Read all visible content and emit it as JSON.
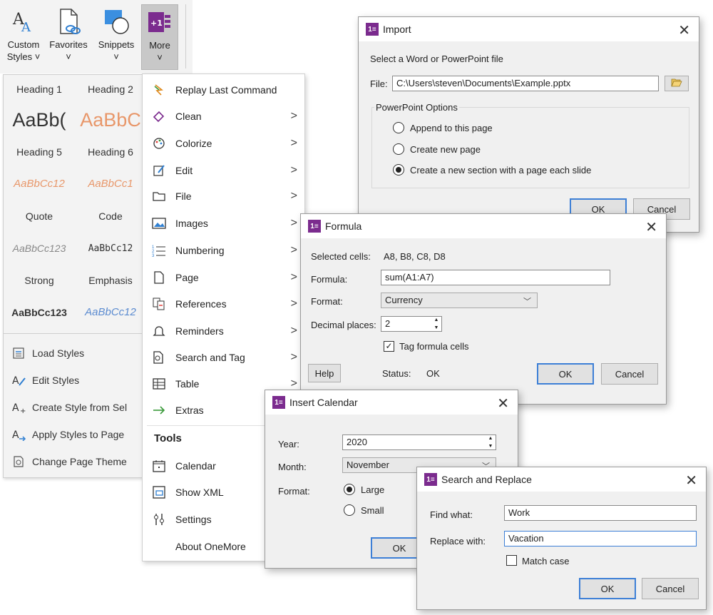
{
  "ribbon": {
    "buttons": [
      {
        "line1": "Custom",
        "line2": "Styles ˅",
        "icon": "custom-styles-icon"
      },
      {
        "line1": "Favorites",
        "line2": "˅",
        "icon": "favorites-icon"
      },
      {
        "line1": "Snippets",
        "line2": "˅",
        "icon": "snippets-icon"
      },
      {
        "line1": "More",
        "line2": "˅",
        "icon": "onemore-icon"
      }
    ]
  },
  "gallery": {
    "styles": [
      "Heading 1",
      "Heading 2",
      "AaBb(",
      "AaBbC",
      "Heading 5",
      "Heading 6",
      "AaBbCc12",
      "AaBbCc1",
      "Quote",
      "Code",
      "AaBbCc123",
      "AaBbCc12",
      "Strong",
      "Emphasis",
      "AaBbCc123",
      "AaBbCc12"
    ],
    "commands": [
      {
        "label": "Load Styles",
        "icon": "load-styles-icon"
      },
      {
        "label": "Edit Styles",
        "icon": "edit-styles-icon"
      },
      {
        "label": "Create Style from Sel",
        "icon": "create-style-icon"
      },
      {
        "label": "Apply Styles to Page",
        "icon": "apply-styles-icon"
      },
      {
        "label": "Change Page Theme",
        "icon": "page-theme-icon"
      }
    ]
  },
  "menu": {
    "items": [
      {
        "label": "Replay Last Command",
        "icon": "replay-icon",
        "submenu": false
      },
      {
        "label": "Clean",
        "icon": "eraser-icon",
        "submenu": true
      },
      {
        "label": "Colorize",
        "icon": "palette-icon",
        "submenu": true
      },
      {
        "label": "Edit",
        "icon": "edit-icon",
        "submenu": true
      },
      {
        "label": "File",
        "icon": "folder-icon",
        "submenu": true
      },
      {
        "label": "Images",
        "icon": "image-icon",
        "submenu": true
      },
      {
        "label": "Numbering",
        "icon": "numbering-icon",
        "submenu": true
      },
      {
        "label": "Page",
        "icon": "page-icon",
        "submenu": true
      },
      {
        "label": "References",
        "icon": "references-icon",
        "submenu": true
      },
      {
        "label": "Reminders",
        "icon": "bell-icon",
        "submenu": true
      },
      {
        "label": "Search and Tag",
        "icon": "search-tag-icon",
        "submenu": true
      },
      {
        "label": "Table",
        "icon": "table-icon",
        "submenu": true
      },
      {
        "label": "Extras",
        "icon": "arrow-right-icon",
        "submenu": true
      }
    ],
    "tools_heading": "Tools",
    "tools": [
      {
        "label": "Calendar",
        "icon": "calendar-icon"
      },
      {
        "label": "Show XML",
        "icon": "xml-icon"
      },
      {
        "label": "Settings",
        "icon": "settings-icon"
      },
      {
        "label": "About OneMore",
        "icon": ""
      }
    ],
    "arrow": ">"
  },
  "import_dialog": {
    "title": "Import",
    "prompt": "Select a Word or PowerPoint file",
    "file_label": "File:",
    "file_value": "C:\\Users\\steven\\Documents\\Example.pptx",
    "group_label": "PowerPoint Options",
    "options": [
      "Append to this page",
      "Create new page",
      "Create a new section with a page each slide"
    ],
    "selected": 2,
    "ok": "OK",
    "cancel": "Cancel"
  },
  "formula_dialog": {
    "title": "Formula",
    "selected_label": "Selected cells:",
    "selected_value": "A8, B8, C8, D8",
    "formula_label": "Formula:",
    "formula_value": "sum(A1:A7)",
    "format_label": "Format:",
    "format_value": "Currency",
    "decimal_label": "Decimal places:",
    "decimal_value": "2",
    "tag_label": "Tag formula cells",
    "tag_checked": true,
    "help": "Help",
    "status_label": "Status:",
    "status_value": "OK",
    "ok": "OK",
    "cancel": "Cancel"
  },
  "calendar_dialog": {
    "title": "Insert Calendar",
    "year_label": "Year:",
    "year_value": "2020",
    "month_label": "Month:",
    "month_value": "November",
    "format_label": "Format:",
    "formats": [
      "Large",
      "Small"
    ],
    "selected_format": 0,
    "ok": "OK"
  },
  "search_dialog": {
    "title": "Search and Replace",
    "find_label": "Find what:",
    "find_value": "Work",
    "replace_label": "Replace with:",
    "replace_value": "Vacation",
    "match_case": "Match case",
    "ok": "OK",
    "cancel": "Cancel"
  }
}
